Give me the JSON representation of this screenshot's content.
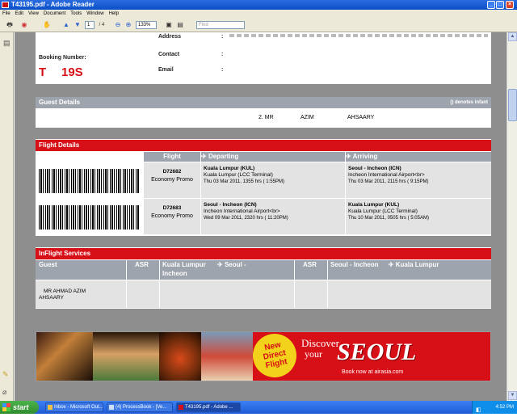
{
  "window": {
    "title": "T43195.pdf - Adobe Reader"
  },
  "menu": [
    "File",
    "Edit",
    "View",
    "Document",
    "Tools",
    "Window",
    "Help"
  ],
  "toolbar": {
    "page_current": "1",
    "page_total": "/ 4",
    "zoom": "133%",
    "find_placeholder": "Find"
  },
  "booking": {
    "address_label": "Address",
    "contact_label": "Contact",
    "email_label": "Email",
    "colon": ":",
    "booking_number_label": "Booking Number:",
    "booking_number_start": "T",
    "booking_number_end": "19S"
  },
  "guest_details": {
    "title": "Guest Details",
    "note": "() denotes infant",
    "guest": {
      "num": "2. MR",
      "first": "AZIM",
      "last": "AHSAARY"
    }
  },
  "flight_details": {
    "title": "Flight Details",
    "col_flight": "Flight",
    "col_departing": "Departing",
    "col_arriving": "Arriving",
    "rows": [
      {
        "flight_no": "D72682",
        "fare": "Economy Promo",
        "dep_city": "Kuala Lumpur (KUL)",
        "dep_terminal": "Kuala Lumpur (LCC Terminal)",
        "dep_time": "Thu 03 Mar 2011, 1355 hrs ( 1:55PM)",
        "arr_city": "Seoul - Incheon (ICN)",
        "arr_terminal": "Incheon International Airport<br>",
        "arr_time": "Thu 03 Mar 2011, 2115 hrs ( 9:15PM)"
      },
      {
        "flight_no": "D72683",
        "fare": "Economy Promo",
        "dep_city": "Seoul - Incheon (ICN)",
        "dep_terminal": "Incheon International Airport<br>",
        "dep_time": "Wed 09 Mar 2011, 2320 hrs ( 11:20PM)",
        "arr_city": "Kuala Lumpur (KUL)",
        "arr_terminal": "Kuala Lumpur (LCC Terminal)",
        "arr_time": "Thu 10 Mar 2011, 0505 hrs ( 5:05AM)"
      }
    ]
  },
  "inflight": {
    "title": "InFlight Services",
    "col_guest": "Guest",
    "col_asr": "ASR",
    "col_seg1_from": "Kuala Lumpur",
    "col_seg1_to": "Seoul -",
    "col_seg1_to2": "Incheon",
    "col_asr2": "ASR",
    "col_seg2_from": "Seoul - Incheon",
    "col_seg2_to": "Kuala Lumpur",
    "guest_name_line1": "MR AHMAD AZIM",
    "guest_name_line2": "AHSAARY"
  },
  "banner": {
    "badge_line1": "New",
    "badge_line2": "Direct",
    "badge_line3": "Flight",
    "discover": "Discover",
    "your": "your",
    "seoul": "SEOUL",
    "cta": "Book now at airasia.com"
  },
  "taskbar": {
    "start": "start",
    "tasks": [
      "Inbox - Microsoft Out...",
      "(4) ProcessBook - [Ve...",
      "T43195.pdf - Adobe ..."
    ],
    "clock": "4:52 PM"
  },
  "colors": {
    "red": "#d70f17",
    "gray_header": "#9da4ad",
    "xp_blue": "#1f5ad8"
  }
}
